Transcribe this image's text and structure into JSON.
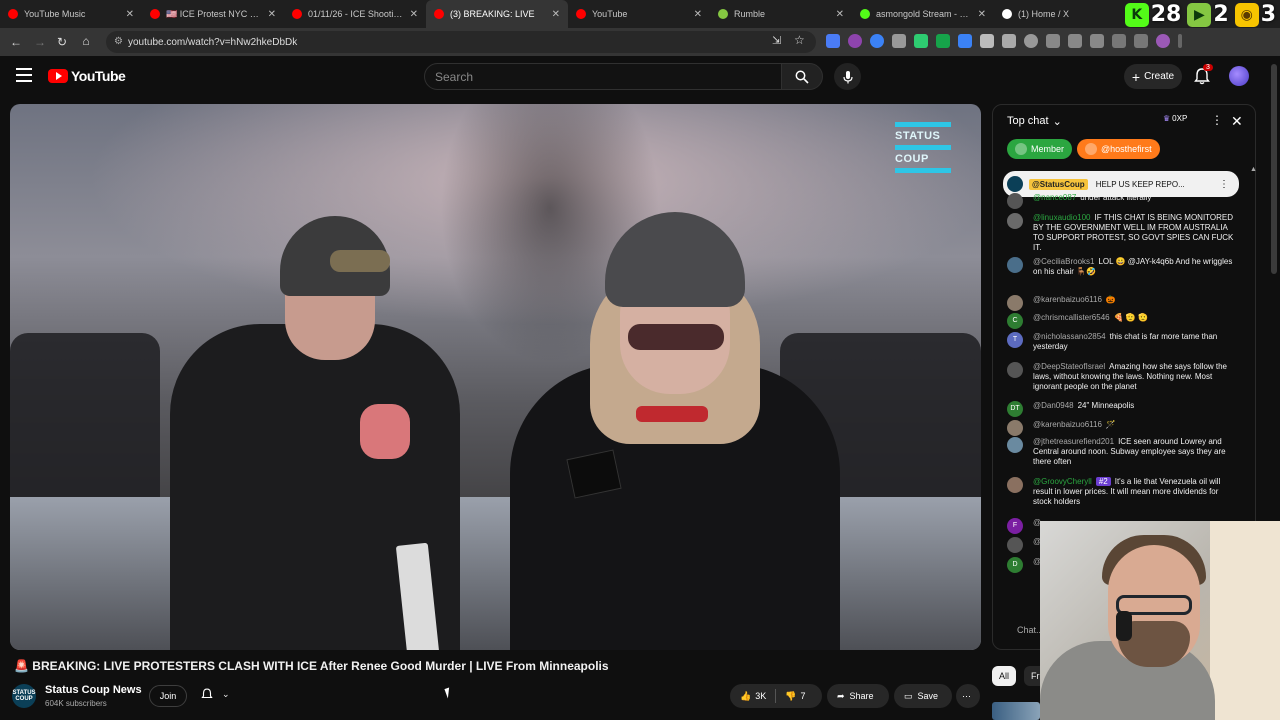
{
  "browser": {
    "tabs": [
      {
        "title": "YouTube Music",
        "color": "#ff0000"
      },
      {
        "title": "🇺🇸 ICE Protest NYC LA Mi...",
        "color": "#ff0000"
      },
      {
        "title": "01/11/26 - ICE Shooting P...",
        "color": "#ff0000"
      },
      {
        "title": "(3) BREAKING: LIVE",
        "color": "#ff0000"
      },
      {
        "title": "YouTube",
        "color": "#ff0000"
      },
      {
        "title": "Rumble",
        "color": "#85c742"
      },
      {
        "title": "asmongold Stream - Wat...",
        "color": "#53fc18"
      },
      {
        "title": "(1) Home / X",
        "color": "#ffffff"
      }
    ],
    "close_glyph": "✕",
    "url": "youtube.com/watch?v=hNw2hkeDbDk",
    "overlay_counts": [
      {
        "icon": "kick-icon",
        "glyph": "K",
        "value": "28",
        "color": "#53fc18"
      },
      {
        "icon": "rumble-icon",
        "glyph": "▶",
        "value": "2",
        "color": "#85c742"
      },
      {
        "icon": "gamer-icon",
        "glyph": "◉",
        "value": "3",
        "color": "#f7c400"
      }
    ]
  },
  "header": {
    "logo_text": "YouTube",
    "search_placeholder": "Search",
    "create_label": "Create",
    "notification_count": "3"
  },
  "video": {
    "watermark_lines": [
      "STATUS",
      "COUP"
    ],
    "title": "🚨 BREAKING: LIVE PROTESTERS CLASH WITH ICE After Renee Good Murder | LIVE From Minneapolis",
    "channel": {
      "name": "Status Coup News",
      "subscribers": "604K subscribers",
      "avatar_text": "STATUS COUP"
    },
    "join_label": "Join",
    "likes": "3K",
    "dislikes": "7",
    "share_label": "Share",
    "save_label": "Save"
  },
  "chat": {
    "title": "Top chat",
    "xp": "0XP",
    "chips": [
      {
        "label": "Member",
        "color": "#2ba640"
      },
      {
        "label": "@hosthefirst",
        "color": "#ff7a1a"
      }
    ],
    "pinned": {
      "author": "@StatusCoup",
      "text": "HELP US KEEP REPO..."
    },
    "messages": [
      {
        "author": "@nance087",
        "text": "under attack literally",
        "member": true,
        "avatar_color": "#555",
        "avatar_letter": ""
      },
      {
        "author": "@linuxaudio100",
        "text": "IF THIS CHAT IS BEING MONITORED BY THE GOVERNMENT WELL IM FROM AUSTRALIA TO SUPPORT PROTEST, SO GOVT SPIES CAN FUCK IT.",
        "member": true,
        "avatar_color": "#6a6a6a",
        "avatar_letter": ""
      },
      {
        "author": "@CeciliaBrooks1",
        "text": "LOL 😀 @JAY-k4q6b And he wriggles on his chair 🪑🤣",
        "member": false,
        "avatar_color": "#4a6e8a",
        "avatar_letter": ""
      },
      {
        "author": "@karenbaizuo6116",
        "text": "🎃",
        "member": false,
        "avatar_color": "#8a7a6a",
        "avatar_letter": ""
      },
      {
        "author": "@chrismcallister6546",
        "text": "🍕 🫡 🫡",
        "member": false,
        "avatar_color": "#2e7d32",
        "avatar_letter": "C"
      },
      {
        "author": "@nicholassano2854",
        "text": "this chat is far more tame than yesterday",
        "member": false,
        "avatar_color": "#5c6bc0",
        "avatar_letter": "T"
      },
      {
        "author": "@DeepStateofIsrael",
        "text": "Amazing how she says follow the laws, without knowing the laws. Nothing new. Most ignorant people on the planet",
        "member": false,
        "avatar_color": "#555",
        "avatar_letter": ""
      },
      {
        "author": "@Dan0948",
        "text": "24\" Minneapolis",
        "member": false,
        "avatar_color": "#2e7d32",
        "avatar_letter": "DT"
      },
      {
        "author": "@karenbaizuo6116",
        "text": "🪄",
        "member": false,
        "avatar_color": "#8a7a6a",
        "avatar_letter": ""
      },
      {
        "author": "@jthetreasurefiend201",
        "text": "ICE seen around Lowrey and Central around noon. Subway employee says they are there often",
        "member": false,
        "avatar_color": "#6a8aa0",
        "avatar_letter": ""
      },
      {
        "author": "@GroovyCheryll",
        "text": "It's a lie that Venezuela oil will result in lower prices. It will mean more dividends for stock holders",
        "member": true,
        "avatar_color": "#8a7060",
        "avatar_letter": "",
        "badge": "#2"
      },
      {
        "author": "@",
        "text": "",
        "member": false,
        "avatar_color": "#7b1fa2",
        "avatar_letter": "F"
      },
      {
        "author": "@",
        "text": "",
        "member": false,
        "avatar_color": "#555",
        "avatar_letter": ""
      },
      {
        "author": "@",
        "text": "",
        "member": false,
        "avatar_color": "#2e7d32",
        "avatar_letter": "D"
      }
    ],
    "input_placeholder": "Chat..."
  },
  "filters": [
    {
      "label": "All",
      "active": true
    },
    {
      "label": "Fr",
      "active": false
    }
  ]
}
